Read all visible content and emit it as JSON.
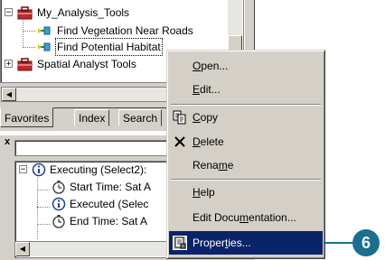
{
  "tree": {
    "items": [
      {
        "label": "My_Analysis_Tools"
      },
      {
        "label": "Find Vegetation Near Roads"
      },
      {
        "label": "Find Potential Habitat"
      },
      {
        "label": "Spatial Analyst Tools"
      }
    ]
  },
  "tabs": [
    {
      "label": "Favorites"
    },
    {
      "label": "Index"
    },
    {
      "label": "Search"
    }
  ],
  "messages": {
    "close_glyph": "x",
    "items": [
      {
        "label": "Executing (Select2):"
      },
      {
        "label": "Start Time: Sat A"
      },
      {
        "label": "Executed (Selec"
      },
      {
        "label": "End Time: Sat A"
      }
    ]
  },
  "context_menu": {
    "items": [
      {
        "before": "",
        "key": "O",
        "after": "pen..."
      },
      {
        "before": "",
        "key": "E",
        "after": "dit..."
      },
      {
        "before": "",
        "key": "C",
        "after": "opy"
      },
      {
        "before": "",
        "key": "D",
        "after": "elete"
      },
      {
        "before": "Rena",
        "key": "m",
        "after": "e"
      },
      {
        "before": "",
        "key": "H",
        "after": "elp"
      },
      {
        "before": "Edit Docu",
        "key": "m",
        "after": "entation..."
      },
      {
        "before": "Proper",
        "key": "t",
        "after": "ies..."
      }
    ]
  },
  "callout": {
    "number": "6"
  },
  "colors": {
    "highlight": "#0a246a",
    "callout": "#1a6e8e",
    "toolbox_red": "#c0282d"
  }
}
